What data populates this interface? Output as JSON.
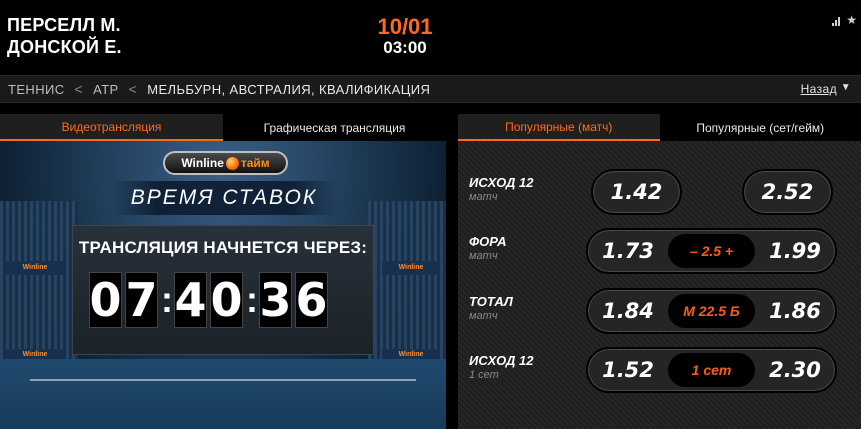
{
  "header": {
    "player1": "ПЕРСЕЛЛ М.",
    "player2": "ДОНСКОЙ Е.",
    "date": "10/01",
    "time": "03:00",
    "icons": [
      "stats-icon",
      "star-icon"
    ]
  },
  "breadcrumb": {
    "items": [
      "ТЕННИС",
      "ATP",
      "МЕЛЬБУРН, АВСТРАЛИЯ, КВАЛИФИКАЦИЯ"
    ],
    "back_label": "Назад"
  },
  "left_tabs": [
    "Видеотрансляция",
    "Графическая трансляция"
  ],
  "video": {
    "logo_text": "Winline",
    "logo_suffix": "тайм",
    "banner": "ВРЕМЯ СТАВОК",
    "countdown_label": "ТРАНСЛЯЦИЯ НАЧНЕТСЯ ЧЕРЕЗ:",
    "digits": [
      "0",
      "7",
      "4",
      "0",
      "3",
      "6"
    ],
    "ad_text": "Winline"
  },
  "right_tabs": [
    "Популярные (матч)",
    "Популярные (сет/гейм)"
  ],
  "markets": [
    {
      "name": "ИСХОД 12",
      "sub": "матч",
      "odd1": "1.42",
      "odd2": "2.52"
    },
    {
      "name": "ФОРА",
      "sub": "матч",
      "odd1": "1.73",
      "mid": "– 2.5 +",
      "odd2": "1.99"
    },
    {
      "name": "ТОТАЛ",
      "sub": "матч",
      "odd1": "1.84",
      "mid": "М 22.5 Б",
      "odd2": "1.86"
    },
    {
      "name": "ИСХОД 12",
      "sub": "1 сет",
      "odd1": "1.52",
      "mid": "1 сет",
      "odd2": "2.30"
    }
  ],
  "colors": {
    "accent": "#ff6a1a",
    "background": "#000000"
  }
}
